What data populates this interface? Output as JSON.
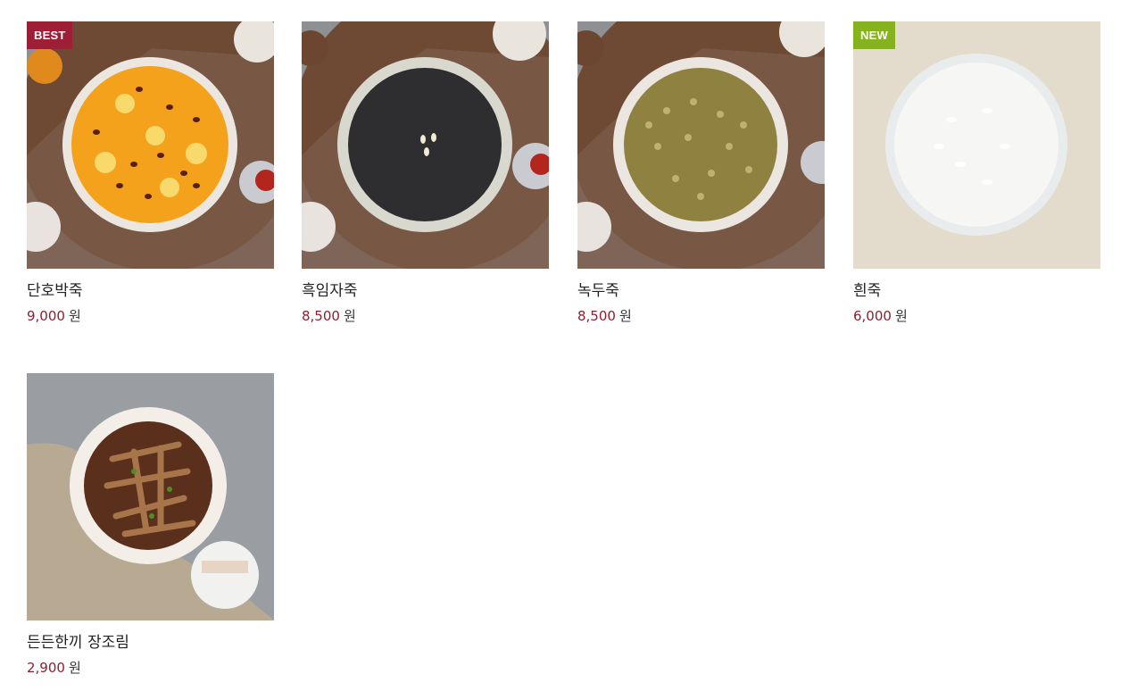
{
  "products": [
    {
      "name": "단호박죽",
      "price": "9,000",
      "unit": "원",
      "badge": "BEST",
      "badge_color": "#9c1f36",
      "porridge_color": "#f4a21b"
    },
    {
      "name": "흑임자죽",
      "price": "8,500",
      "unit": "원",
      "badge": "",
      "badge_color": "",
      "porridge_color": "#2e2e30"
    },
    {
      "name": "녹두죽",
      "price": "8,500",
      "unit": "원",
      "badge": "",
      "badge_color": "",
      "porridge_color": "#8f8240"
    },
    {
      "name": "흰죽",
      "price": "6,000",
      "unit": "원",
      "badge": "NEW",
      "badge_color": "#86b31d",
      "porridge_color": "#f4f4f2"
    },
    {
      "name": "든든한끼 장조림",
      "price": "2,900",
      "unit": "원",
      "badge": "",
      "badge_color": "",
      "porridge_color": "#5a2f1c"
    }
  ],
  "colors": {
    "price": "#8c1f2f",
    "title": "#222222"
  }
}
